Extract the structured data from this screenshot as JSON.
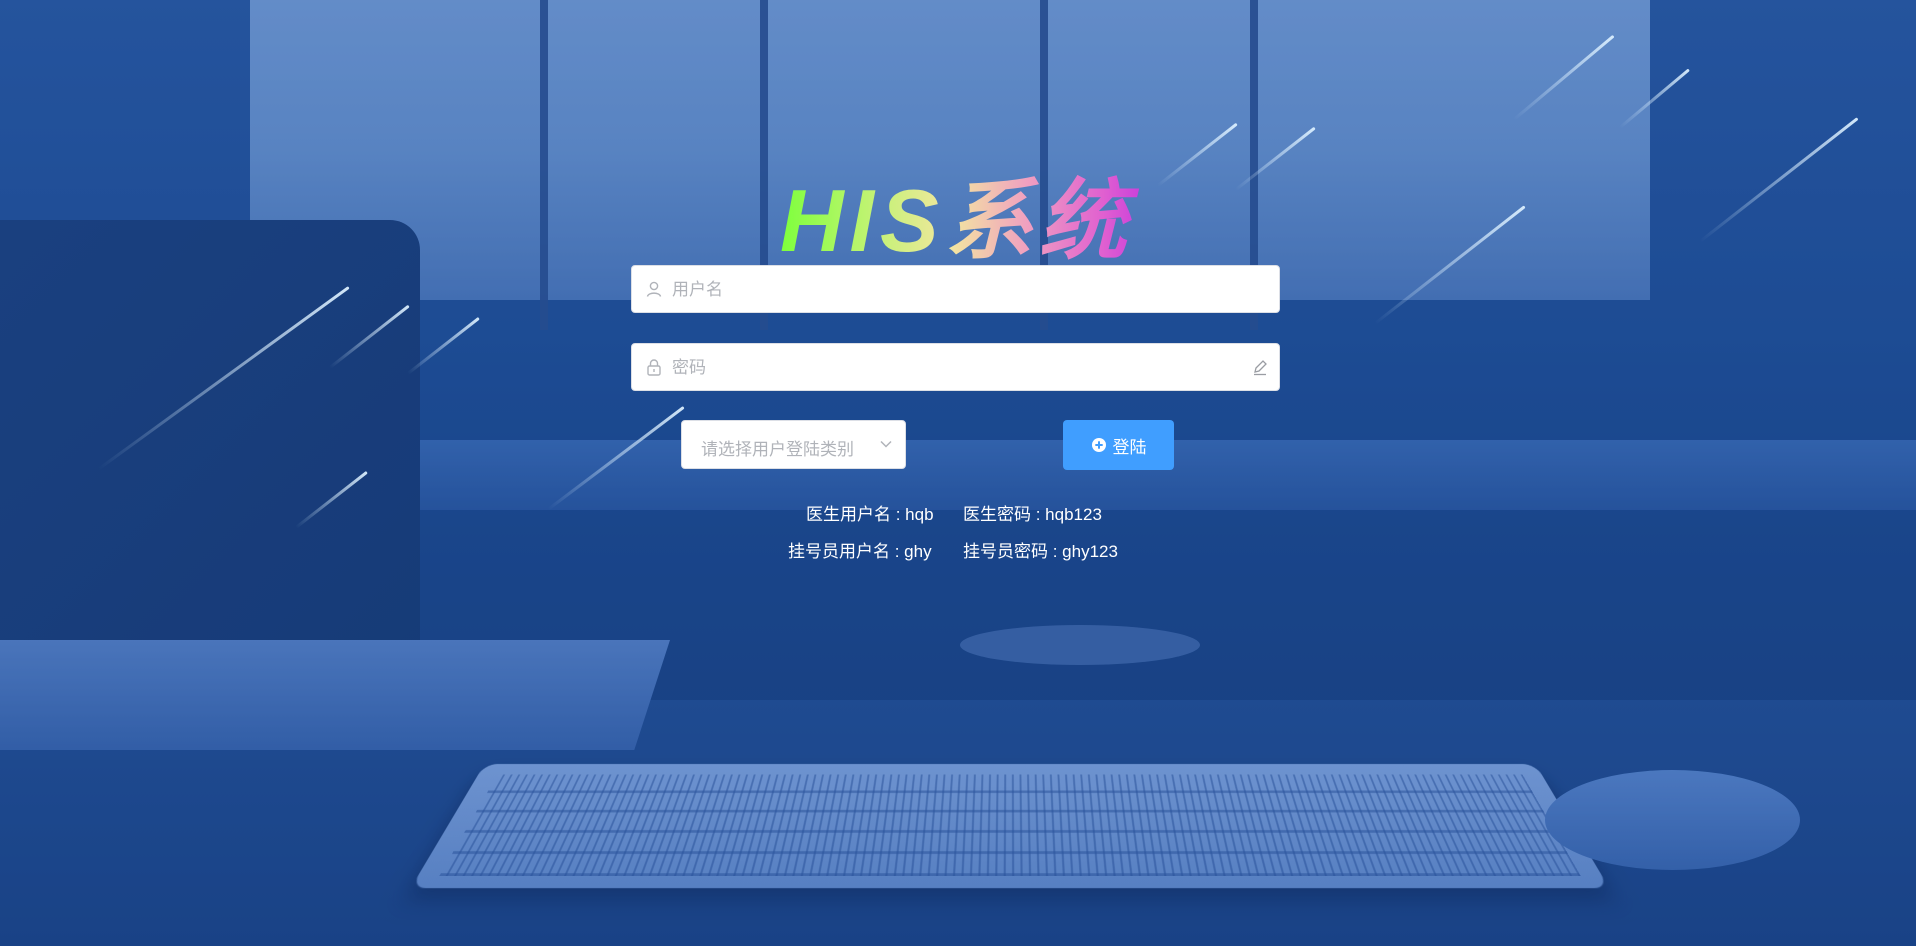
{
  "title": "HIS系统",
  "form": {
    "username_placeholder": "用户名",
    "password_placeholder": "密码",
    "user_type_placeholder": "请选择用户登陆类别",
    "login_label": "登陆"
  },
  "hints": {
    "doctor_username": "医生用户名 : hqb",
    "doctor_password": "医生密码 : hqb123",
    "registrar_username": "挂号员用户名 : ghy",
    "registrar_password": "挂号员密码 : ghy123"
  },
  "icons": {
    "username": "user-icon",
    "password": "lock-icon",
    "password_suffix": "edit-icon",
    "select": "chevron-down-icon",
    "login": "plus-circle-icon"
  },
  "colors": {
    "primary": "#409eff",
    "background": "#1f4f93"
  }
}
